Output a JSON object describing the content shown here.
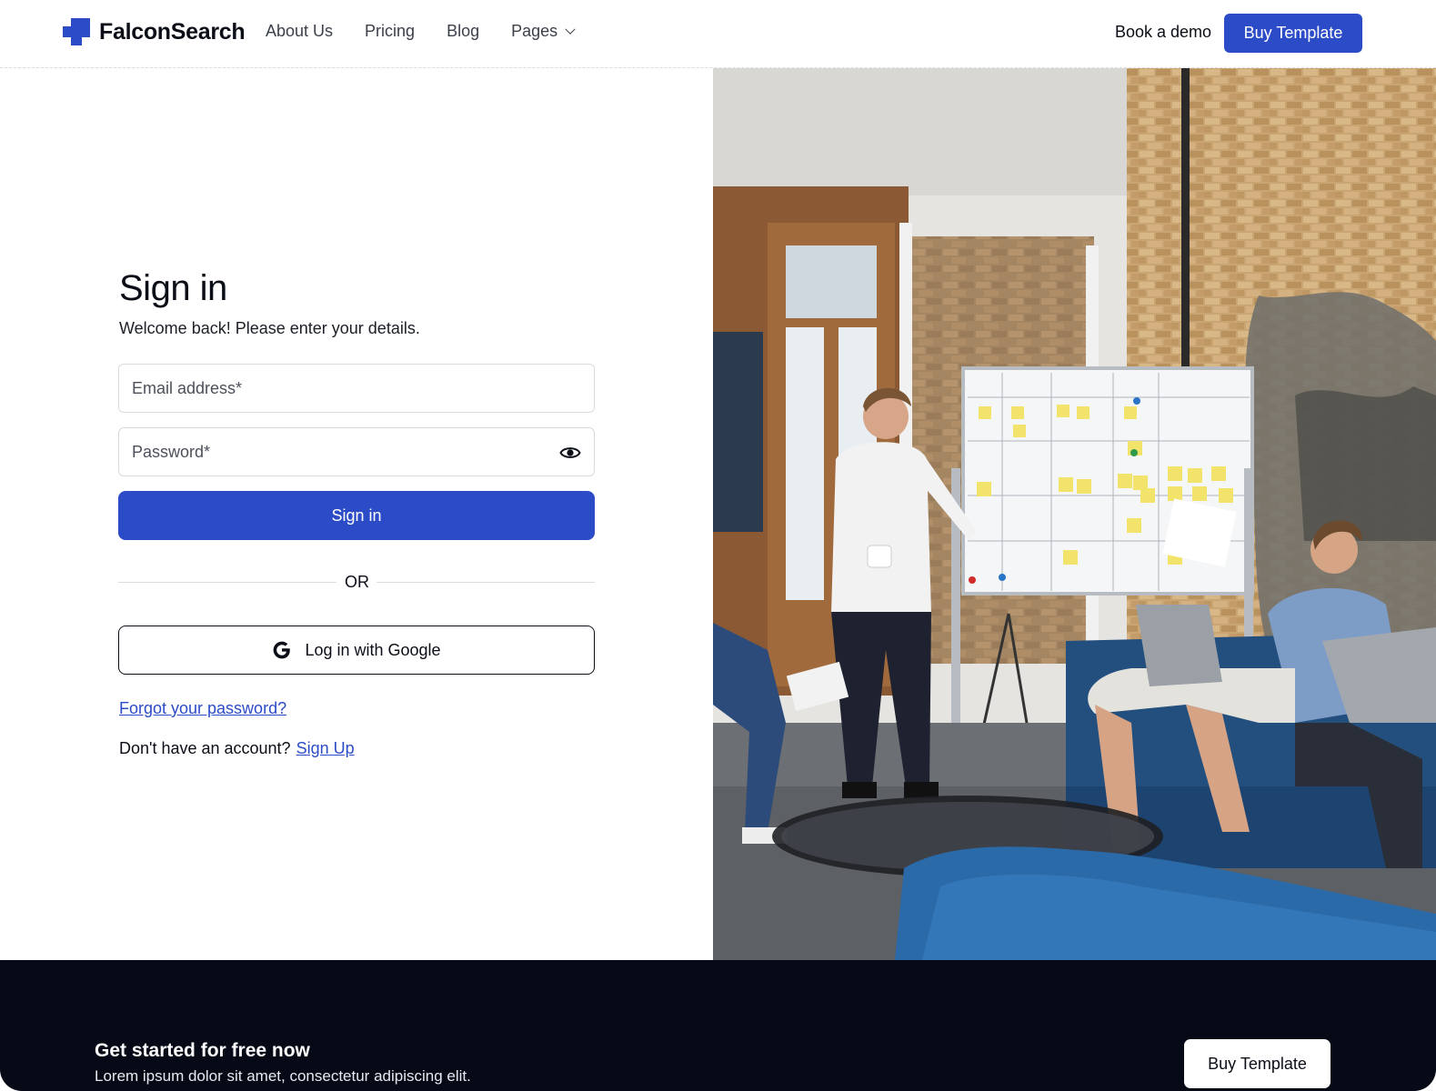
{
  "nav": {
    "logo_text": "FalconSearch",
    "links": [
      "About Us",
      "Pricing",
      "Blog",
      "Pages"
    ],
    "book_demo": "Book a demo",
    "buy_template": "Buy Template"
  },
  "signin": {
    "title": "Sign in",
    "subtitle": "Welcome back! Please enter your details.",
    "email_placeholder": "Email address*",
    "password_placeholder": "Password*",
    "submit_label": "Sign in",
    "divider": "OR",
    "google_label": "Log in with Google",
    "forgot_label": "Forgot your password?",
    "no_account_text": "Don't have an account?",
    "signup_label": "Sign Up"
  },
  "footer": {
    "cta_title": "Get started for free now",
    "cta_subtitle": "Lorem ipsum dolor sit amet, consectetur adipiscing elit.",
    "buy_template": "Buy Template"
  },
  "colors": {
    "brand": "#2c4bc7",
    "footer_bg": "#060a17"
  }
}
